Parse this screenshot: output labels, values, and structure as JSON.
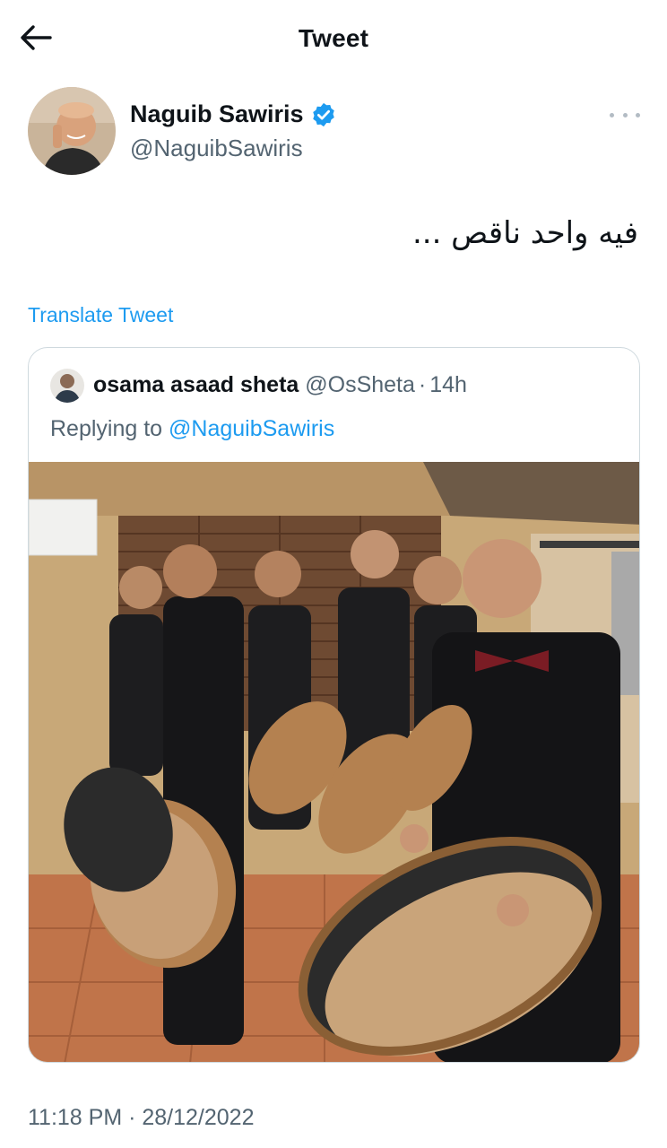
{
  "header": {
    "title": "Tweet",
    "back_icon": "arrow-left-icon"
  },
  "author": {
    "name": "Naguib Sawiris",
    "handle": "@NaguibSawiris",
    "verified": true,
    "verified_color": "#1d9bf0"
  },
  "tweet": {
    "text": "فيه واحد ناقص ...",
    "translate_label": "Translate Tweet",
    "timestamp": "11:18 PM · 28/12/2022"
  },
  "quoted": {
    "author_name": "osama asaad sheta",
    "handle": "@OsSheta",
    "separator": "·",
    "age": "14h",
    "replying_prefix": "Replying to",
    "replying_to": "@NaguibSawiris"
  },
  "colors": {
    "text": "#0f1419",
    "secondary": "#536471",
    "accent": "#1d9bf0",
    "border": "#cfd9de"
  }
}
